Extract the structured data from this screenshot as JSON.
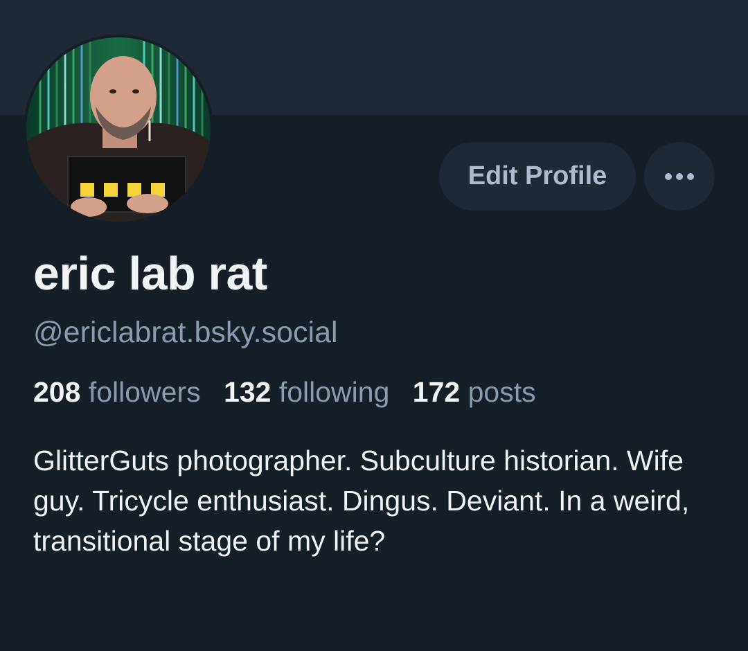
{
  "profile": {
    "display_name": "eric lab rat",
    "handle": "@ericlabrat.bsky.social",
    "bio": "GlitterGuts photographer. Subculture historian. Wife guy. Tricycle enthusiast. Dingus. Deviant. In a weird, transitional stage of my life?",
    "avatar_icon": "avatar-photo"
  },
  "stats": {
    "followers_count": "208",
    "followers_label": "followers",
    "following_count": "132",
    "following_label": "following",
    "posts_count": "172",
    "posts_label": "posts"
  },
  "actions": {
    "edit_profile_label": "Edit Profile",
    "more_icon": "ellipsis-icon"
  },
  "colors": {
    "background": "#161e27",
    "banner": "#1e2935",
    "button_bg": "#1e2935",
    "text_primary": "#f1f3f5",
    "text_secondary": "#8a9bb0"
  }
}
